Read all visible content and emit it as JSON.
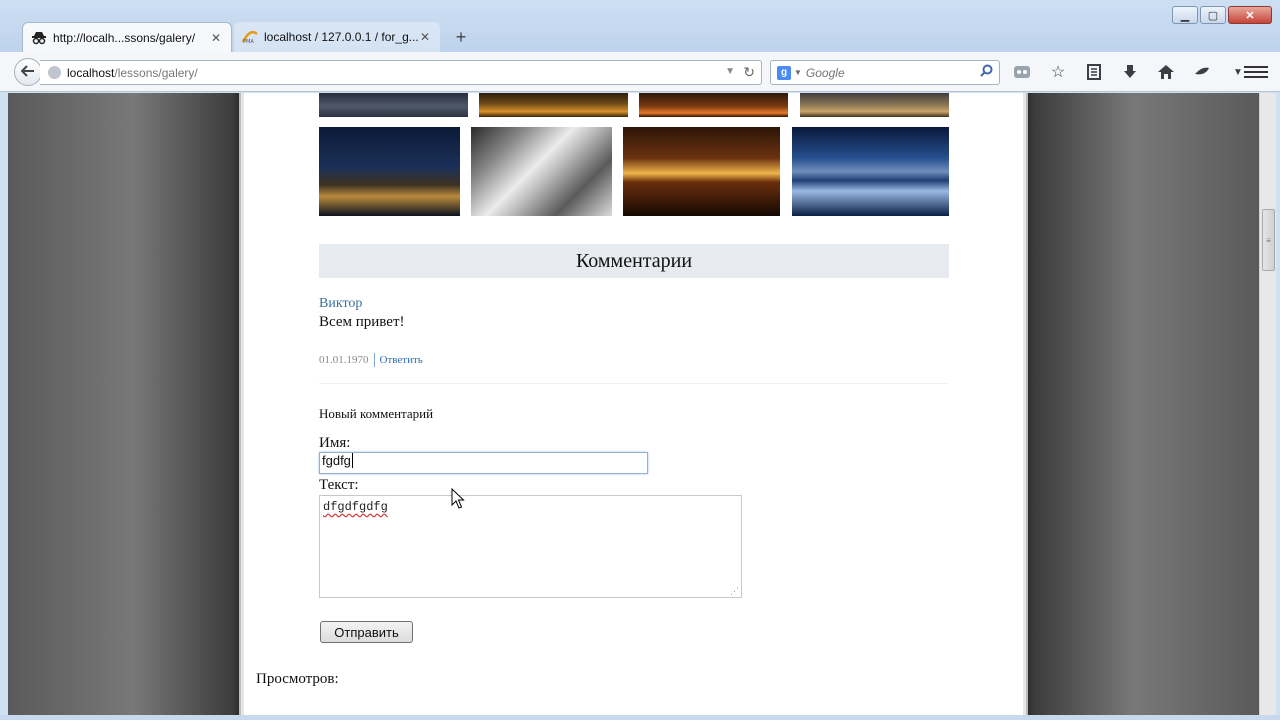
{
  "window": {
    "minimize_glyph": "▁",
    "maximize_glyph": "▢",
    "close_glyph": "✕"
  },
  "tabs": [
    {
      "label": "http://localh...ssons/galery/",
      "icon": "incognito-icon",
      "close_glyph": "✕",
      "active": true
    },
    {
      "label": "localhost / 127.0.0.1 / for_g...",
      "icon": "phpmyadmin-icon",
      "close_glyph": "✕",
      "active": false
    }
  ],
  "new_tab_glyph": "+",
  "address": {
    "host": "localhost",
    "path": "/lessons/galery/"
  },
  "search": {
    "engine_letter": "g",
    "placeholder": "Google"
  },
  "toolbar": {
    "icons": [
      "addon-icon",
      "bookmark-star-icon",
      "bookmarks-list-icon",
      "download-icon",
      "home-icon",
      "extension-icon",
      "dropdown-icon"
    ]
  },
  "page": {
    "comments_heading": "Комментарии",
    "comment": {
      "author": "Виктор",
      "text": "Всем привет!",
      "date": "01.01.1970",
      "reply_label": "Ответить"
    },
    "form": {
      "title": "Новый комментарий",
      "name_label": "Имя:",
      "name_value": "fgdfg",
      "text_label": "Текст:",
      "text_value": "dfgdfgdfg",
      "submit_label": "Отправить"
    },
    "views_label": "Просмотров:"
  },
  "colors": {
    "link": "#3a6fa0",
    "heading_bg": "#e7eaee",
    "input_focus": "#8fb3d8"
  }
}
